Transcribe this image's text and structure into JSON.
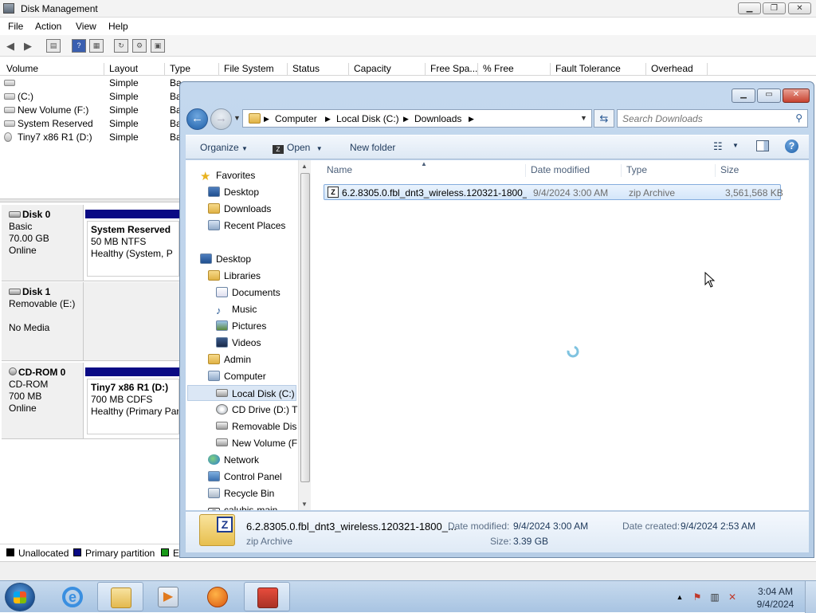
{
  "disk_management": {
    "title": "Disk Management",
    "menu": [
      "File",
      "Action",
      "View",
      "Help"
    ],
    "columns": [
      "Volume",
      "Layout",
      "Type",
      "File System",
      "Status",
      "Capacity",
      "Free Spa...",
      "% Free",
      "Fault Tolerance",
      "Overhead"
    ],
    "volumes": [
      {
        "name": "",
        "layout": "Simple",
        "type": "Ba"
      },
      {
        "name": "(C:)",
        "layout": "Simple",
        "type": "Ba"
      },
      {
        "name": "New Volume (F:)",
        "layout": "Simple",
        "type": "Ba"
      },
      {
        "name": "System Reserved",
        "layout": "Simple",
        "type": "Ba"
      },
      {
        "name": "Tiny7 x86 R1 (D:)",
        "layout": "Simple",
        "type": "Ba"
      }
    ],
    "disks": [
      {
        "name": "Disk 0",
        "lines": [
          "Basic",
          "70.00 GB",
          "Online"
        ],
        "partition": {
          "name": "System Reserved",
          "detail": "50 MB NTFS",
          "status": "Healthy (System, P"
        }
      },
      {
        "name": "Disk 1",
        "lines": [
          "Removable (E:)",
          "",
          "No Media"
        ]
      },
      {
        "name": "CD-ROM 0",
        "lines": [
          "CD-ROM",
          "700 MB",
          "Online"
        ],
        "partition": {
          "name": "Tiny7 x86 R1  (D:)",
          "detail": "700 MB CDFS",
          "status": "Healthy (Primary Par"
        }
      }
    ],
    "legend": [
      {
        "label": "Unallocated",
        "color": "#000000"
      },
      {
        "label": "Primary partition",
        "color": "#0a0a84"
      },
      {
        "label": "E",
        "color": "#1a9a1a"
      }
    ]
  },
  "explorer": {
    "breadcrumb": [
      "Computer",
      "Local Disk (C:)",
      "Downloads"
    ],
    "search_placeholder": "Search Downloads",
    "commands": {
      "organize": "Organize",
      "open": "Open",
      "new_folder": "New folder"
    },
    "nav": {
      "favorites": "Favorites",
      "desktop": "Desktop",
      "downloads": "Downloads",
      "recent": "Recent Places",
      "desktop2": "Desktop",
      "libraries": "Libraries",
      "documents": "Documents",
      "music": "Music",
      "pictures": "Pictures",
      "videos": "Videos",
      "admin": "Admin",
      "computer": "Computer",
      "local_disk": "Local Disk (C:)",
      "cd_drive": "CD Drive (D:) T",
      "removable": "Removable Dis",
      "new_volume": "New Volume (F",
      "network": "Network",
      "control_panel": "Control Panel",
      "recycle_bin": "Recycle Bin",
      "calubis": "calubis-main"
    },
    "columns": {
      "name": "Name",
      "date": "Date modified",
      "type": "Type",
      "size": "Size"
    },
    "file": {
      "name": "6.2.8305.0.fbl_dnt3_wireless.120321-1800_...",
      "date": "9/4/2024 3:00 AM",
      "type": "zip Archive",
      "size": "3,561,568 KB"
    },
    "details": {
      "name": "6.2.8305.0.fbl_dnt3_wireless.120321-1800_...",
      "type": "zip Archive",
      "modified_label": "Date modified:",
      "modified": "9/4/2024 3:00 AM",
      "created_label": "Date created:",
      "created": "9/4/2024 2:53 AM",
      "size_label": "Size:",
      "size": "3.39 GB"
    }
  },
  "taskbar": {
    "time": "3:04 AM",
    "date": "9/4/2024"
  }
}
